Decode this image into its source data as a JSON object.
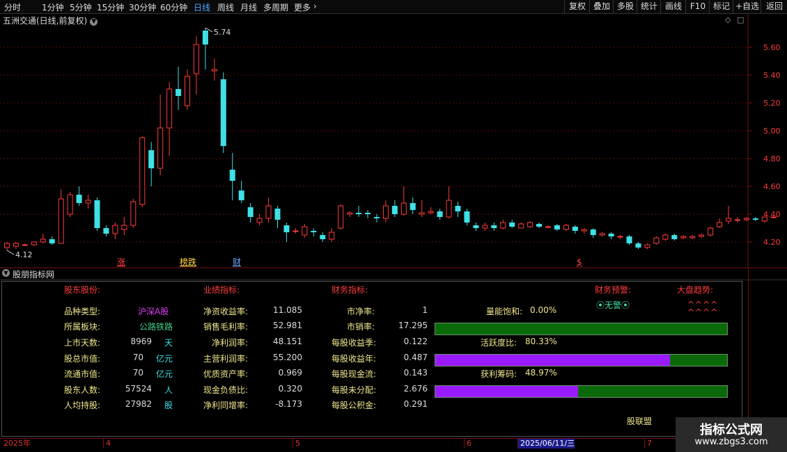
{
  "toolbar": {
    "periods": [
      "分时",
      "1分钟",
      "5分钟",
      "15分钟",
      "30分钟",
      "60分钟",
      "日线",
      "周线",
      "月线",
      "多周期",
      "更多"
    ],
    "active": "日线",
    "right_buttons": [
      "复权",
      "叠加",
      "多股",
      "统计",
      "画线",
      "F10",
      "标记",
      "+自选",
      "返回"
    ]
  },
  "chart": {
    "title": "五洲交通(日线,前复权)",
    "high_label": "5.74",
    "low_label": "4.12",
    "y_ticks": [
      "5.60",
      "5.40",
      "5.20",
      "5.00",
      "4.80",
      "4.60",
      "4.40",
      "4.20"
    ],
    "markers": [
      {
        "text": "涨",
        "color": "#ff4040"
      },
      {
        "text": "榜跌",
        "color": "#ffd54a"
      },
      {
        "text": "财",
        "color": "#6aa8ff"
      },
      {
        "text": "$",
        "color": "#ff4040"
      }
    ],
    "candles": [
      [
        4.16,
        4.19,
        4.14,
        4.2
      ],
      [
        4.17,
        4.19,
        4.15,
        4.2
      ],
      [
        4.18,
        4.18,
        4.17,
        4.19
      ],
      [
        4.18,
        4.2,
        4.17,
        4.2
      ],
      [
        4.2,
        4.22,
        4.19,
        4.26
      ],
      [
        4.22,
        4.19,
        4.18,
        4.24
      ],
      [
        4.19,
        4.51,
        4.19,
        4.58
      ],
      [
        4.4,
        4.54,
        4.38,
        4.56
      ],
      [
        4.54,
        4.48,
        4.46,
        4.6
      ],
      [
        4.48,
        4.5,
        4.44,
        4.54
      ],
      [
        4.5,
        4.3,
        4.28,
        4.52
      ],
      [
        4.3,
        4.26,
        4.24,
        4.32
      ],
      [
        4.26,
        4.32,
        4.22,
        4.34
      ],
      [
        4.29,
        4.32,
        4.25,
        4.38
      ],
      [
        4.32,
        4.49,
        4.3,
        4.51
      ],
      [
        4.47,
        4.95,
        4.45,
        4.96
      ],
      [
        4.86,
        4.73,
        4.6,
        4.92
      ],
      [
        4.73,
        5.02,
        4.68,
        5.26
      ],
      [
        5.02,
        5.3,
        4.82,
        5.35
      ],
      [
        5.3,
        5.25,
        5.15,
        5.46
      ],
      [
        5.18,
        5.39,
        5.15,
        5.44
      ],
      [
        5.41,
        5.62,
        5.26,
        5.68
      ],
      [
        5.72,
        5.62,
        5.44,
        5.74
      ],
      [
        5.43,
        5.44,
        5.36,
        5.52
      ],
      [
        5.37,
        4.89,
        4.84,
        5.42
      ],
      [
        4.72,
        4.64,
        4.5,
        4.84
      ],
      [
        4.57,
        4.5,
        4.48,
        4.64
      ],
      [
        4.45,
        4.38,
        4.34,
        4.48
      ],
      [
        4.34,
        4.37,
        4.32,
        4.4
      ],
      [
        4.37,
        4.46,
        4.34,
        4.52
      ],
      [
        4.44,
        4.36,
        4.3,
        4.46
      ],
      [
        4.32,
        4.27,
        4.2,
        4.34
      ],
      [
        4.28,
        4.28,
        4.26,
        4.3
      ],
      [
        4.25,
        4.31,
        4.23,
        4.33
      ],
      [
        4.28,
        4.27,
        4.24,
        4.3
      ],
      [
        4.25,
        4.22,
        4.2,
        4.27
      ],
      [
        4.22,
        4.27,
        4.2,
        4.3
      ],
      [
        4.3,
        4.46,
        4.29,
        4.47
      ],
      [
        4.4,
        4.41,
        4.38,
        4.42
      ],
      [
        4.41,
        4.4,
        4.38,
        4.46
      ],
      [
        4.41,
        4.4,
        4.37,
        4.43
      ],
      [
        4.38,
        4.37,
        4.34,
        4.4
      ],
      [
        4.37,
        4.46,
        4.34,
        4.5
      ],
      [
        4.46,
        4.4,
        4.38,
        4.5
      ],
      [
        4.4,
        4.48,
        4.39,
        4.6
      ],
      [
        4.48,
        4.43,
        4.4,
        4.52
      ],
      [
        4.4,
        4.41,
        4.38,
        4.5
      ],
      [
        4.41,
        4.42,
        4.4,
        4.45
      ],
      [
        4.42,
        4.38,
        4.36,
        4.44
      ],
      [
        4.38,
        4.5,
        4.37,
        4.6
      ],
      [
        4.46,
        4.42,
        4.38,
        4.49
      ],
      [
        4.42,
        4.34,
        4.32,
        4.44
      ],
      [
        4.32,
        4.3,
        4.28,
        4.34
      ],
      [
        4.3,
        4.32,
        4.28,
        4.34
      ],
      [
        4.32,
        4.3,
        4.28,
        4.34
      ],
      [
        4.3,
        4.34,
        4.29,
        4.36
      ],
      [
        4.34,
        4.31,
        4.3,
        4.36
      ],
      [
        4.3,
        4.33,
        4.3,
        4.34
      ],
      [
        4.31,
        4.34,
        4.3,
        4.35
      ],
      [
        4.33,
        4.31,
        4.3,
        4.34
      ],
      [
        4.31,
        4.31,
        4.3,
        4.32
      ],
      [
        4.32,
        4.29,
        4.28,
        4.33
      ],
      [
        4.29,
        4.32,
        4.28,
        4.33
      ],
      [
        4.31,
        4.28,
        4.26,
        4.32
      ],
      [
        4.28,
        4.29,
        4.26,
        4.3
      ],
      [
        4.29,
        4.25,
        4.23,
        4.3
      ],
      [
        4.25,
        4.26,
        4.24,
        4.27
      ],
      [
        4.26,
        4.24,
        4.22,
        4.27
      ],
      [
        4.24,
        4.24,
        4.22,
        4.25
      ],
      [
        4.24,
        4.19,
        4.18,
        4.25
      ],
      [
        4.19,
        4.16,
        4.15,
        4.2
      ],
      [
        4.16,
        4.18,
        4.15,
        4.19
      ],
      [
        4.19,
        4.23,
        4.18,
        4.24
      ],
      [
        4.22,
        4.25,
        4.21,
        4.26
      ],
      [
        4.25,
        4.22,
        4.21,
        4.26
      ],
      [
        4.23,
        4.24,
        4.22,
        4.25
      ],
      [
        4.23,
        4.24,
        4.22,
        4.25
      ],
      [
        4.24,
        4.25,
        4.23,
        4.26
      ],
      [
        4.25,
        4.3,
        4.24,
        4.31
      ],
      [
        4.31,
        4.34,
        4.3,
        4.37
      ],
      [
        4.35,
        4.37,
        4.33,
        4.46
      ],
      [
        4.36,
        4.36,
        4.34,
        4.38
      ],
      [
        4.36,
        4.37,
        4.35,
        4.38
      ],
      [
        4.37,
        4.36,
        4.35,
        4.38
      ],
      [
        4.35,
        4.38,
        4.34,
        4.38
      ],
      [
        4.38,
        4.38,
        4.37,
        4.38
      ]
    ],
    "date_axis": [
      "2025年",
      "4",
      "5",
      "6",
      "2025/06/11/三",
      "7"
    ]
  },
  "panel": {
    "header": "股朋指标网",
    "sections": {
      "shareholder": "股东股份:",
      "performance": "业绩指标:",
      "finance": "财务指标:",
      "warning": "财务预警:",
      "trend": "大盘趋势:"
    },
    "shareholder_rows": [
      {
        "label": "品种类型:",
        "value": "沪深A股",
        "unit": ""
      },
      {
        "label": "所属板块:",
        "value": "公路铁路",
        "unit": ""
      },
      {
        "label": "上市天数:",
        "value": "8969",
        "unit": "天"
      },
      {
        "label": "股总市值:",
        "value": "70",
        "unit": "亿元"
      },
      {
        "label": "流通市值:",
        "value": "70",
        "unit": "亿元"
      },
      {
        "label": "股东人数:",
        "value": "57524",
        "unit": "人"
      },
      {
        "label": "人均持股:",
        "value": "27982",
        "unit": "股"
      }
    ],
    "performance_rows": [
      {
        "label": "净资收益率:",
        "value": "11.085"
      },
      {
        "label": "销售毛利率:",
        "value": "52.981"
      },
      {
        "label": "净利润率:",
        "value": "48.151"
      },
      {
        "label": "主营利润率:",
        "value": "55.200"
      },
      {
        "label": "优质资产率:",
        "value": "0.969"
      },
      {
        "label": "现金负债比:",
        "value": "0.320"
      },
      {
        "label": "净利同增率:",
        "value": "-8.173"
      }
    ],
    "finance_rows": [
      {
        "label": "市净率:",
        "value": "1"
      },
      {
        "label": "市销率:",
        "value": "17.295"
      },
      {
        "label": "每股收益季:",
        "value": "0.122"
      },
      {
        "label": "每股收益年:",
        "value": "0.487"
      },
      {
        "label": "每股现金流:",
        "value": "0.143"
      },
      {
        "label": "每股未分配:",
        "value": "2.676"
      },
      {
        "label": "每股公积金:",
        "value": "0.291"
      }
    ],
    "warning_text": "无警",
    "trend_text_1": "^^^^",
    "trend_text_2": "^^^^",
    "meters": [
      {
        "label": "量能饱和:",
        "value": "0.00%",
        "fraction": 0.0
      },
      {
        "label": "活跃度比:",
        "value": "80.33%",
        "fraction": 0.8033
      },
      {
        "label": "获利筹码:",
        "value": "48.97%",
        "fraction": 0.4897
      }
    ],
    "footer_link": "股联盟"
  },
  "watermark": {
    "line1": "指标公式网",
    "line2": "www.zbgs3.com"
  },
  "colors": {
    "up": "#ff3b3b",
    "down": "#3fe0e6",
    "grid": "#5a0b0b",
    "purple": "#9a1aff",
    "green": "#0a6a0a"
  }
}
